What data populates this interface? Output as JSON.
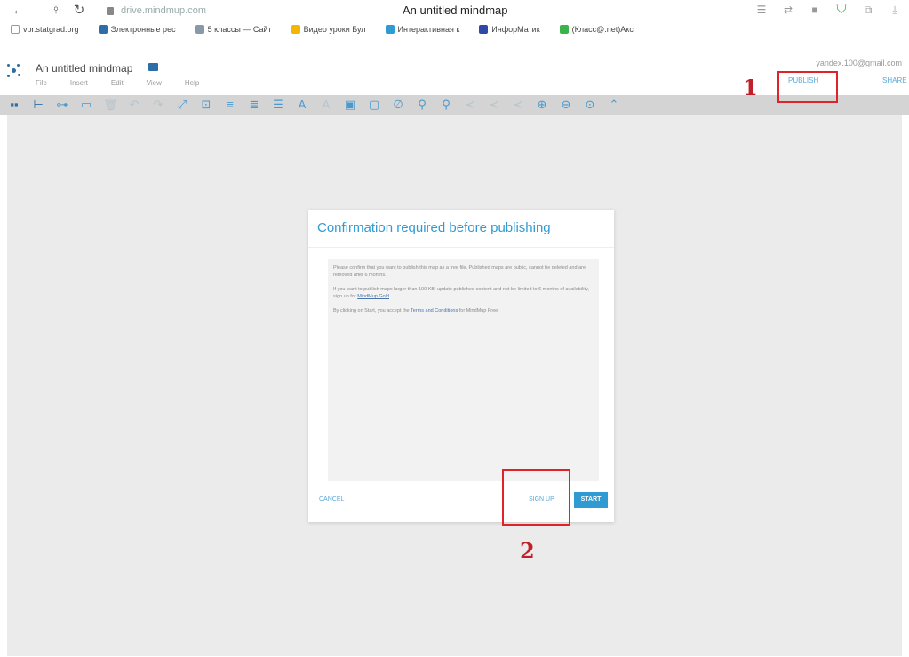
{
  "browser": {
    "url": "drive.mindmup.com",
    "page_title": "An untitled mindmap"
  },
  "bookmarks": [
    {
      "label": "vpr.statgrad.org",
      "color": "#ffffff"
    },
    {
      "label": "Электронные рес",
      "color": "#2e6ea6"
    },
    {
      "label": "5 классы — Сайт",
      "color": "#8899aa"
    },
    {
      "label": "Видео уроки Бул",
      "color": "#f2b705"
    },
    {
      "label": "Интерактивная к",
      "color": "#2f9bd2"
    },
    {
      "label": "ИнфорМатик",
      "color": "#3048a8"
    },
    {
      "label": "(Класс@.net)Акс",
      "color": "#3cb34a"
    }
  ],
  "app": {
    "title": "An untitled mindmap",
    "menu": [
      "File",
      "Insert",
      "Edit",
      "View",
      "Help"
    ],
    "user_email": "yandex.100@gmail.com",
    "publish_label": "PUBLISH",
    "share_label": "SHARE"
  },
  "dialog": {
    "title": "Confirmation required before publishing",
    "para1": "Please confirm that you want to publish this map as a free file. Published maps are public, cannot be deleted and are removed after 6 months.",
    "para2_text": "If you want to publish maps larger than 100 KB, update published content and not be limited to 6 months of availability, sign up for",
    "para2_link": "MindMup Gold",
    "para3_text": "By clicking on Start, you accept the",
    "para3_link": "Terms and Conditions",
    "para3_end": "for MindMup Free.",
    "cancel_label": "CANCEL",
    "signup_label": "SIGN UP",
    "start_label": "START"
  },
  "annotations": {
    "label1": "1",
    "label2": "2"
  },
  "colors": {
    "accent": "#2f9bd2",
    "annotation_red": "#e0232a",
    "canvas": "#ebebeb",
    "toolbar": "#d4d4d4"
  }
}
